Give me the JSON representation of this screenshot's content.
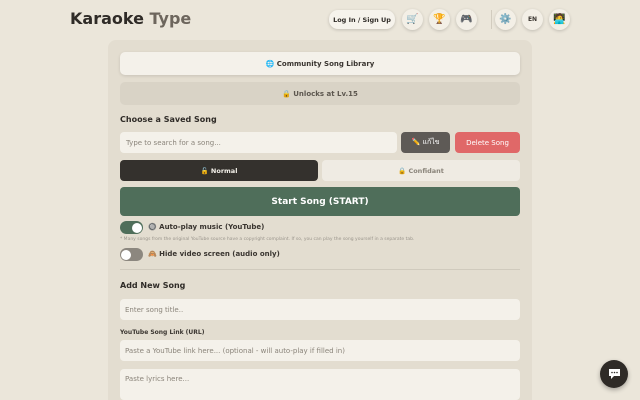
{
  "header": {
    "brand_main": "Karaoke",
    "brand_accent": "Type",
    "login_label": "Log In / Sign Up",
    "language": "EN"
  },
  "library": {
    "community_label": "🌐 Community Song Library",
    "unlock_label": "🔒 Unlocks at Lv.15"
  },
  "saved": {
    "title": "Choose a Saved Song",
    "search_placeholder": "Type to search for a song...",
    "edit_label": "✏️ แก้ไข",
    "delete_label": "Delete Song"
  },
  "modes": {
    "normal": "🔓 Normal",
    "confidant": "🔒 Confidant"
  },
  "start_label": "Start Song (START)",
  "autoplay": {
    "label": "🔘 Auto-play music (YouTube)",
    "enabled": true,
    "note": "* Many songs from the original YouTube source have a copyright complaint. If so, you can play the song yourself in a separate tab."
  },
  "hide_video": {
    "label": "🙈 Hide video screen (audio only)",
    "enabled": false
  },
  "add_song": {
    "title": "Add New Song",
    "title_placeholder": "Enter song title..",
    "link_label": "YouTube Song Link (URL)",
    "link_placeholder": "Paste a YouTube link here... (optional - will auto-play if filled in)",
    "lyrics_placeholder": "Paste lyrics here..."
  },
  "icons": [
    "cart-icon",
    "trophy-icon",
    "gamepad-icon",
    "gear-icon",
    "avatar-icon",
    "chat-icon"
  ],
  "colors": {
    "primary_green": "#4f6e5a",
    "danger_red": "#e06868",
    "dark": "#34312d"
  }
}
